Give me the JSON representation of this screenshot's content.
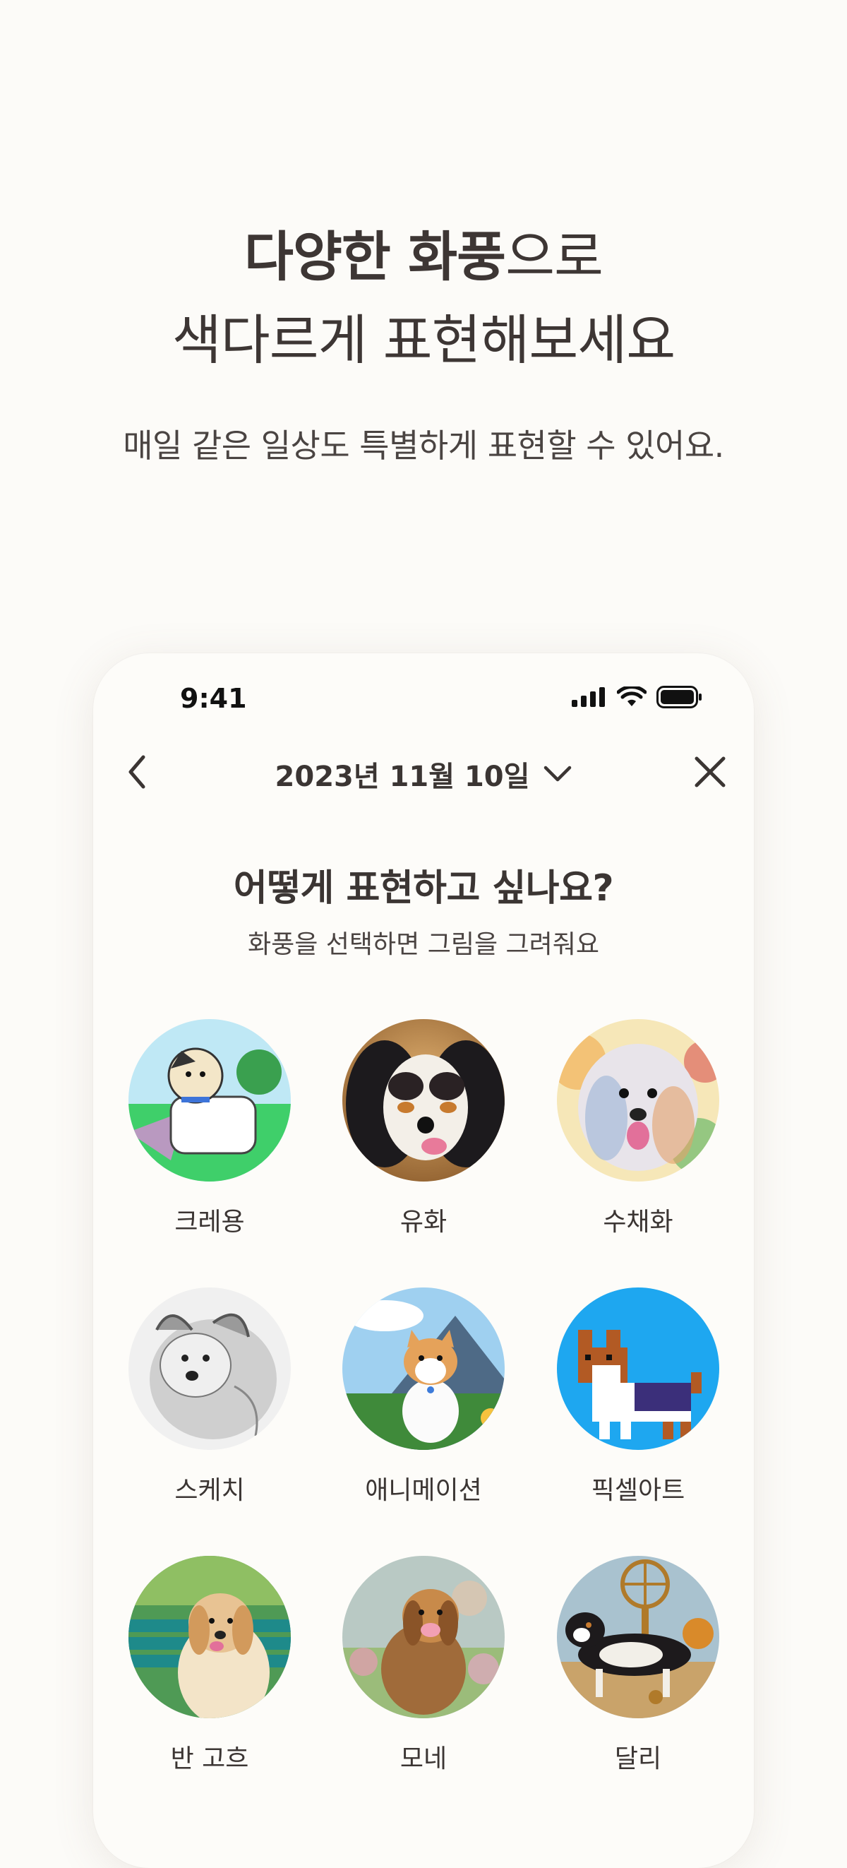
{
  "promo": {
    "headline_line1_bold": "다양한 화풍",
    "headline_line1_light": "으로",
    "headline_line2": "색다르게 표현해보세요",
    "subhead": "매일 같은 일상도 특별하게 표현할 수 있어요."
  },
  "status_bar": {
    "time": "9:41"
  },
  "nav": {
    "date": "2023년 11월 10일"
  },
  "question": {
    "title": "어떻게 표현하고 싶나요?",
    "subtitle": "화풍을 선택하면 그림을 그려줘요"
  },
  "styles": [
    {
      "label": "크레용",
      "icon": "crayon-dog-thumbnail"
    },
    {
      "label": "유화",
      "icon": "oil-painting-dog-thumbnail"
    },
    {
      "label": "수채화",
      "icon": "watercolor-dog-thumbnail"
    },
    {
      "label": "스케치",
      "icon": "sketch-dog-thumbnail"
    },
    {
      "label": "애니메이션",
      "icon": "animation-dog-thumbnail"
    },
    {
      "label": "픽셀아트",
      "icon": "pixel-art-dog-thumbnail"
    },
    {
      "label": "반 고흐",
      "icon": "van-gogh-dog-thumbnail"
    },
    {
      "label": "모네",
      "icon": "monet-dog-thumbnail"
    },
    {
      "label": "달리",
      "icon": "dali-dog-thumbnail"
    }
  ],
  "colors": {
    "background": "#fcfbf8",
    "text": "#3b3533"
  }
}
